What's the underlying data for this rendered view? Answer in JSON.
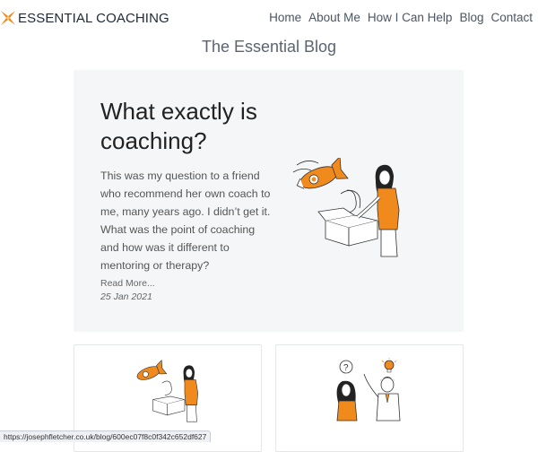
{
  "brand": {
    "name": "ESSENTIAL COACHING",
    "logo_icon": "x-star-logo-icon",
    "accent": "#f08a1d"
  },
  "nav": {
    "items": [
      "Home",
      "About Me",
      "How I Can Help",
      "Blog",
      "Contact"
    ]
  },
  "page": {
    "heading": "The Essential Blog"
  },
  "featured": {
    "title": "What exactly is coaching?",
    "excerpt": "This was my question to a friend who recommend her own coach to me, many years ago. I didn’t get it. What was the point of coaching and how was it different to mentoring or therapy?",
    "read_more": "Read More...",
    "date": "25 Jan 2021",
    "illustration": "woman-launching-rocket-from-box-illustration"
  },
  "cards": [
    {
      "illustration": "woman-launching-rocket-from-box-illustration"
    },
    {
      "illustration": "two-people-question-and-idea-illustration"
    }
  ],
  "status_bar": {
    "url": "https://josephfletcher.co.uk/blog/600ec07f8c0f342c652df627"
  }
}
